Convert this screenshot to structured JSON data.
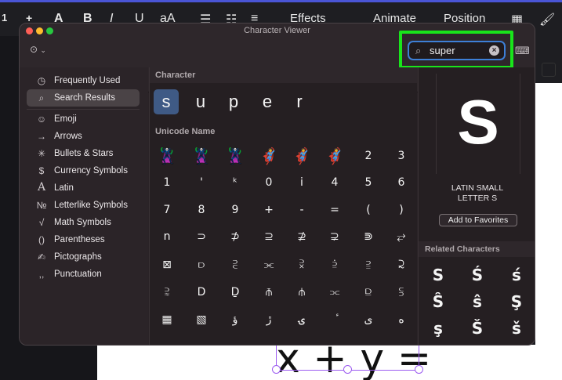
{
  "background": {
    "toolbar": {
      "zoom": "1",
      "plus": "+",
      "font_a": "A",
      "bold": "B",
      "italic": "I",
      "underline": "U",
      "size": "aA",
      "effects": "Effects",
      "animate": "Animate",
      "position": "Position"
    },
    "canvas_formula": "x + y ="
  },
  "window": {
    "title": "Character Viewer",
    "search": {
      "value": "super",
      "placeholder": "Search"
    },
    "traffic_lights": [
      "#ff5f57",
      "#febc2e",
      "#28c840"
    ]
  },
  "sidebar": {
    "items": [
      {
        "label": "Frequently Used",
        "icon": "clock-icon",
        "glyph": "◷"
      },
      {
        "label": "Search Results",
        "icon": "search-icon",
        "glyph": "⌕",
        "selected": true
      },
      {
        "label": "Emoji",
        "icon": "emoji-icon",
        "glyph": "☺"
      },
      {
        "label": "Arrows",
        "icon": "arrow-icon",
        "glyph": "→"
      },
      {
        "label": "Bullets & Stars",
        "icon": "star-icon",
        "glyph": "✳"
      },
      {
        "label": "Currency Symbols",
        "icon": "dollar-icon",
        "glyph": "$"
      },
      {
        "label": "Latin",
        "icon": "latin-icon",
        "glyph": "A"
      },
      {
        "label": "Letterlike Symbols",
        "icon": "numero-icon",
        "glyph": "№"
      },
      {
        "label": "Math Symbols",
        "icon": "sqrt-icon",
        "glyph": "√"
      },
      {
        "label": "Parentheses",
        "icon": "parentheses-icon",
        "glyph": "()"
      },
      {
        "label": "Pictographs",
        "icon": "pictograph-icon",
        "glyph": "✍"
      },
      {
        "label": "Punctuation",
        "icon": "punctuation-icon",
        "glyph": ",,"
      }
    ]
  },
  "main": {
    "character_header": "Character",
    "characters": [
      "s",
      "u",
      "p",
      "e",
      "r"
    ],
    "unicode_header": "Unicode Name",
    "grid": [
      [
        "🦹",
        "🦹",
        "🦹",
        "🦸",
        "🦸",
        "🦸",
        "2",
        "3"
      ],
      [
        "1",
        "'",
        "ᵏ",
        "0",
        "i",
        "4",
        "5",
        "6"
      ],
      [
        "7",
        "8",
        "9",
        "+",
        "-",
        "=",
        "(",
        ")"
      ],
      [
        "n",
        "⊃",
        "⊅",
        "⊇",
        "⊉",
        "⊋",
        "⋑",
        "⥂"
      ],
      [
        "⊠",
        "⫐",
        "⫔",
        "⫘",
        "⫂",
        "⫄",
        "⫆",
        "⫈"
      ],
      [
        "⫊",
        "D",
        "Ḏ",
        "⫚",
        "⫛",
        "⫗",
        "⫒",
        "⫓"
      ],
      [
        "▦",
        "▧",
        "ؤ",
        "ڙ",
        "ۍ",
        "ٔ",
        "ى",
        "ه"
      ]
    ]
  },
  "detail": {
    "glyph": "S",
    "name_line1": "LATIN SMALL",
    "name_line2": "LETTER S",
    "favorites_button": "Add to Favorites",
    "related_header": "Related Characters",
    "related": [
      "S",
      "Ś",
      "ś",
      "Ŝ",
      "ŝ",
      "Ş",
      "ş",
      "Š",
      "š"
    ]
  }
}
